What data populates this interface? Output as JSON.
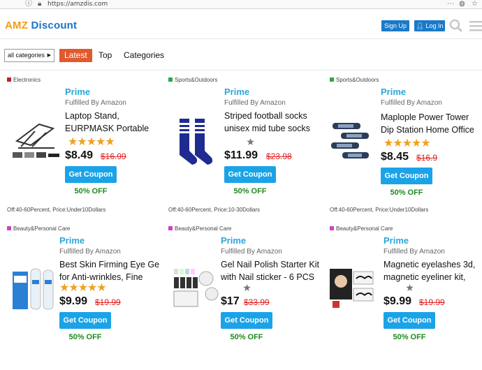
{
  "browser": {
    "url": "https://amzdis.com"
  },
  "header": {
    "logo_part1": "AMZ",
    "logo_part2": "Discount",
    "signup_label": "Sign Up",
    "login_label": "Log In"
  },
  "nav": {
    "category_select": "all categories",
    "tabs": [
      "Latest",
      "Top",
      "Categories"
    ]
  },
  "colors": {
    "accent": "#e05a2e",
    "brand": "#1a7ac8",
    "prime": "#2aa7df",
    "coupon": "#1ba3e8",
    "off_text": "#1f8a1f",
    "old_price": "#e02020"
  },
  "products": [
    {
      "category": "Electronics",
      "cat_color": "#c0202a",
      "prime": "Prime",
      "fulfilled": "Fulfilled By Amazon",
      "title_line1": "Laptop Stand,",
      "title_line2": "EURPMASK Portable",
      "rating": 5,
      "price": "$8.49",
      "old_price": "$16.99",
      "coupon": "Get Coupon",
      "discount": "50% OFF",
      "tags": "Off:40-60Percent, Price:Under10Dollars",
      "icon": "laptop-stand-image"
    },
    {
      "category": "Sports&Outdoors",
      "cat_color": "#2aa84a",
      "prime": "Prime",
      "fulfilled": "Fulfilled By Amazon",
      "title_line1": "Striped football socks",
      "title_line2": "unisex mid tube socks",
      "rating": 0,
      "price": "$11.99",
      "old_price": "$23.98",
      "coupon": "Get Coupon",
      "discount": "50% OFF",
      "tags": "Off:40-60Percent, Price:10-30Dollars",
      "icon": "socks-image"
    },
    {
      "category": "Sports&Outdoors",
      "cat_color": "#2aa84a",
      "prime": "Prime",
      "fulfilled": "Fulfilled By Amazon",
      "title_line1": "Maplople Power Tower",
      "title_line2": "Dip Station Home Office",
      "rating": 4.5,
      "price": "$8.45",
      "old_price": "$16.9",
      "coupon": "Get Coupon",
      "discount": "50% OFF",
      "tags": "Off:40-60Percent, Price:Under10Dollars",
      "icon": "pushup-bars-image"
    },
    {
      "category": "Beauty&Personal Care",
      "cat_color": "#d040c8",
      "prime": "Prime",
      "fulfilled": "Fulfilled By Amazon",
      "title_line1": "Best Skin Firming Eye Gel",
      "title_line2": "for Anti-wrinkles, Fine",
      "rating": 5,
      "price": "$9.99",
      "old_price": "$19.99",
      "coupon": "Get Coupon",
      "discount": "50% OFF",
      "icon": "eye-gel-image"
    },
    {
      "category": "Beauty&Personal Care",
      "cat_color": "#d040c8",
      "prime": "Prime",
      "fulfilled": "Fulfilled By Amazon",
      "title_line1": "Gel Nail Polish Starter Kit",
      "title_line2": "with Nail sticker - 6 PCS",
      "rating": 0,
      "price": "$17",
      "old_price": "$33.99",
      "coupon": "Get Coupon",
      "discount": "50% OFF",
      "icon": "nail-polish-image"
    },
    {
      "category": "Beauty&Personal Care",
      "cat_color": "#d040c8",
      "prime": "Prime",
      "fulfilled": "Fulfilled By Amazon",
      "title_line1": "Magnetic eyelashes 3d,",
      "title_line2": "magnetic eyeliner kit,",
      "rating": 0,
      "price": "$9.99",
      "old_price": "$19.99",
      "coupon": "Get Coupon",
      "discount": "50% OFF",
      "icon": "eyelashes-image"
    }
  ]
}
